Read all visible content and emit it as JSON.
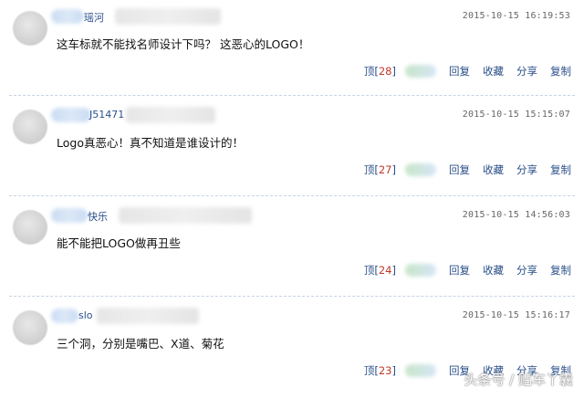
{
  "comments": [
    {
      "name_fragment": "瑶河",
      "timestamp": "2015-10-15 16:19:53",
      "text": "这车标就不能找名师设计下吗？ 这恶心的LOGO！",
      "upvote_label": "顶",
      "votes": "28",
      "reply": "回复",
      "favorite": "收藏",
      "share": "分享",
      "copy": "复制"
    },
    {
      "name_fragment": "J51471",
      "timestamp": "2015-10-15 15:15:07",
      "text": "Logo真恶心！真不知道是谁设计的！",
      "upvote_label": "顶",
      "votes": "27",
      "reply": "回复",
      "favorite": "收藏",
      "share": "分享",
      "copy": "复制"
    },
    {
      "name_fragment": "快乐",
      "timestamp": "2015-10-15 14:56:03",
      "text": "能不能把LOGO做再丑些",
      "upvote_label": "顶",
      "votes": "24",
      "reply": "回复",
      "favorite": "收藏",
      "share": "分享",
      "copy": "复制"
    },
    {
      "name_fragment": "slo",
      "timestamp": "2015-10-15 15:16:17",
      "text": "三个洞，分别是嘴巴、X道、菊花",
      "upvote_label": "顶",
      "votes": "23",
      "reply": "回复",
      "favorite": "收藏",
      "share": "分享",
      "copy": "复制"
    }
  ],
  "watermark": "头条号 / 贴车丫囊"
}
